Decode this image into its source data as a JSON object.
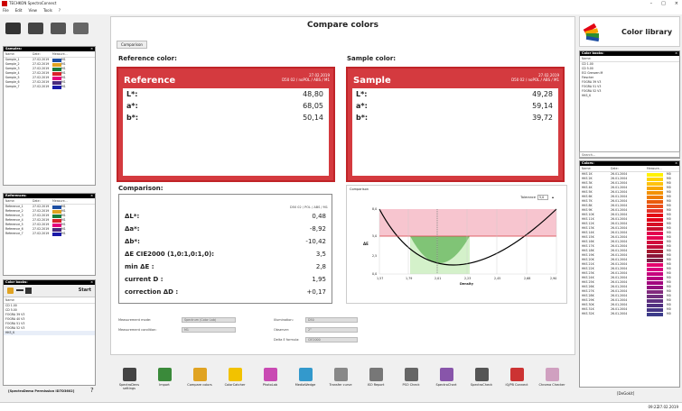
{
  "window": {
    "title": "TECHKON SpectroConnect",
    "controls": [
      "–",
      "□",
      "×"
    ]
  },
  "menu": [
    "File",
    "Edit",
    "View",
    "Tools",
    "?"
  ],
  "samples": {
    "title": "Samples:",
    "columns": [
      "Name:",
      "Date:",
      "Measure..."
    ],
    "rows": [
      {
        "name": "Sample_1",
        "date": "27.02.2019",
        "color": "#1d4fa3",
        "m": "M1"
      },
      {
        "name": "Sample_2",
        "date": "27.02.2019",
        "color": "#e0a322",
        "m": "M1"
      },
      {
        "name": "Sample_3",
        "date": "27.02.2019",
        "color": "#1b7d3b",
        "m": "M1"
      },
      {
        "name": "Sample_4",
        "date": "27.02.2019",
        "color": "#d9232a",
        "m": "M1"
      },
      {
        "name": "Sample_5",
        "date": "27.02.2019",
        "color": "#e4007c",
        "m": "M1"
      },
      {
        "name": "Sample_6",
        "date": "27.02.2019",
        "color": "#4a2b7d",
        "m": "M1"
      },
      {
        "name": "Sample_7",
        "date": "27.02.2019",
        "color": "#1a1aa8",
        "m": "M1"
      }
    ]
  },
  "references": {
    "title": "References:",
    "columns": [
      "Name:",
      "Date:",
      "Measure..."
    ],
    "rows": [
      {
        "name": "Reference_1",
        "date": "27.02.2019",
        "color": "#1d4fa3",
        "m": "M1"
      },
      {
        "name": "Reference_2",
        "date": "27.02.2019",
        "color": "#e0a322",
        "m": "M1"
      },
      {
        "name": "Reference_3",
        "date": "27.02.2019",
        "color": "#1b7d3b",
        "m": "M1"
      },
      {
        "name": "Reference_4",
        "date": "27.02.2019",
        "color": "#d9232a",
        "m": "M1"
      },
      {
        "name": "Reference_5",
        "date": "27.02.2019",
        "color": "#e4007c",
        "m": "M1"
      },
      {
        "name": "Reference_6",
        "date": "27.02.2019",
        "color": "#4a2b7d",
        "m": "M1"
      },
      {
        "name": "Reference_7",
        "date": "27.02.2019",
        "color": "#1a1aa8",
        "m": "M1"
      }
    ]
  },
  "colorbooks_left": {
    "title": "Color books:",
    "start_label": "Start",
    "column": "Name:",
    "items": [
      "CD 1.00",
      "CD 5.00",
      "FOGRA 39 V3",
      "FOGRA 40 V3",
      "FOGRA 51 V3",
      "FOGRA 52 V3",
      "HKS_K"
    ]
  },
  "license_label": "[SpectroDemo Permission ID7D3602]",
  "main": {
    "title": "Compare colors",
    "tab": "Comparison",
    "reference_heading": "Reference color:",
    "sample_heading": "Sample color:",
    "reference": {
      "name": "Reference",
      "date": "27.02.2019",
      "cond": "D50 02 / noPOL / ABS / M1",
      "L": "48,80",
      "a": "68,05",
      "b": "50,14"
    },
    "sample": {
      "name": "Sample",
      "date": "27.02.2019",
      "cond": "D50 02 / noPOL / ABS / M1",
      "L": "49,28",
      "a": "59,14",
      "b": "39,72"
    },
    "labels": {
      "L": "L*:",
      "a": "a*:",
      "b": "b*:"
    },
    "comparison_heading": "Comparison:",
    "comparison_cond": "D50 02 / POL / ABS / M1",
    "comparison_rows": [
      {
        "k": "ΔL*:",
        "v": "0,48"
      },
      {
        "k": "Δa*:",
        "v": "-8,92"
      },
      {
        "k": "Δb*:",
        "v": "-10,42"
      },
      {
        "k": "ΔE CIE2000 (1,0:1,0:1,0):",
        "v": "3,5"
      },
      {
        "k": "min ΔE :",
        "v": "2,8"
      },
      {
        "k": "current D :",
        "v": "1,95"
      },
      {
        "k": "correction ΔD :",
        "v": "+0,17"
      }
    ],
    "graph": {
      "label": "Comparison",
      "tolerance_label": "Tolerance",
      "tolerance_value": "5,0",
      "ylabel": "ΔE",
      "xlabel": "Density",
      "yticks": [
        "8,0",
        "5,0",
        "2,5",
        "0,0"
      ],
      "xticks": [
        "1,57",
        "1,79",
        "2,01",
        "2,23",
        "2,45",
        "2,68",
        "2,90"
      ]
    },
    "settings": {
      "mode_label": "Measurement mode:",
      "mode_value": "Spectrum (Color Lab)",
      "cond_label": "Measurement condition:",
      "cond_value": "M1",
      "illum_label": "Illumination:",
      "illum_value": "D50",
      "observer_label": "Observer:",
      "observer_value": "2°",
      "formula_label": "Delta E formula:",
      "formula_value": "CIE2000"
    }
  },
  "tools": [
    {
      "label": "SpectroDens settings",
      "color": "#444"
    },
    {
      "label": "Import",
      "color": "#3a8a3a"
    },
    {
      "label": "Compare colors",
      "color": "#e0a322"
    },
    {
      "label": "ColorCatcher",
      "color": "#f2c200"
    },
    {
      "label": "PhotoLab",
      "color": "#c94ab3"
    },
    {
      "label": "MediaWedge",
      "color": "#3399cc"
    },
    {
      "label": "Transfer curve",
      "color": "#888"
    },
    {
      "label": "ISO Report",
      "color": "#777"
    },
    {
      "label": "PSO Check",
      "color": "#666"
    },
    {
      "label": "SpectroChart",
      "color": "#8855aa"
    },
    {
      "label": "SpectroCheck",
      "color": "#555"
    },
    {
      "label": "iQ/PB Connect",
      "color": "#cc3333"
    },
    {
      "label": "Chroma Checker",
      "color": "#d0a0c0"
    }
  ],
  "right": {
    "library_title": "Color library",
    "colorbooks_title": "Color books:",
    "colorbooks_column": "Name:",
    "colorbooks_items": [
      "CD 1.00",
      "CD 5.00",
      "ECI Grenzen M",
      "Fiescher",
      "FOGRA 39 V3",
      "FOGRA 51 V3",
      "FOGRA 52 V3",
      "HKS_K"
    ],
    "search_placeholder": "Search...",
    "colors_title": "Colors:",
    "colors_columns": [
      "Name:",
      "Date:",
      "Measure..."
    ],
    "colors_rows": [
      {
        "n": "HKS 1K",
        "d": "26.01.2004",
        "c": "#fff200",
        "m": "M0"
      },
      {
        "n": "HKS 2K",
        "d": "26.01.2004",
        "c": "#ffd400",
        "m": "M0"
      },
      {
        "n": "HKS 3K",
        "d": "26.01.2004",
        "c": "#ffc20e",
        "m": "M0"
      },
      {
        "n": "HKS 4K",
        "d": "26.01.2004",
        "c": "#f7a600",
        "m": "M0"
      },
      {
        "n": "HKS 5K",
        "d": "26.01.2004",
        "c": "#f39200",
        "m": "M0"
      },
      {
        "n": "HKS 6K",
        "d": "26.01.2004",
        "c": "#ef7d00",
        "m": "M0"
      },
      {
        "n": "HKS 7K",
        "d": "26.01.2004",
        "c": "#ea5b0c",
        "m": "M0"
      },
      {
        "n": "HKS 8K",
        "d": "26.01.2004",
        "c": "#e94e1b",
        "m": "M0"
      },
      {
        "n": "HKS 9K",
        "d": "26.01.2004",
        "c": "#e6352b",
        "m": "M0"
      },
      {
        "n": "HKS 10K",
        "d": "26.01.2004",
        "c": "#e30613",
        "m": "M0"
      },
      {
        "n": "HKS 11K",
        "d": "26.01.2004",
        "c": "#e2001a",
        "m": "M0"
      },
      {
        "n": "HKS 12K",
        "d": "26.01.2004",
        "c": "#d60f24",
        "m": "M0"
      },
      {
        "n": "HKS 13K",
        "d": "26.01.2004",
        "c": "#c8102e",
        "m": "M0"
      },
      {
        "n": "HKS 14K",
        "d": "26.01.2004",
        "c": "#e3004f",
        "m": "M0"
      },
      {
        "n": "HKS 15K",
        "d": "26.01.2004",
        "c": "#e40050",
        "m": "M0"
      },
      {
        "n": "HKS 16K",
        "d": "26.01.2004",
        "c": "#d20a3c",
        "m": "M0"
      },
      {
        "n": "HKS 17K",
        "d": "26.01.2004",
        "c": "#c00d3a",
        "m": "M0"
      },
      {
        "n": "HKS 18K",
        "d": "26.01.2004",
        "c": "#a6192e",
        "m": "M0"
      },
      {
        "n": "HKS 19K",
        "d": "26.01.2004",
        "c": "#8a1538",
        "m": "M0"
      },
      {
        "n": "HKS 20K",
        "d": "26.01.2004",
        "c": "#7d2248",
        "m": "M0"
      },
      {
        "n": "HKS 21K",
        "d": "26.01.2004",
        "c": "#e5006d",
        "m": "M0"
      },
      {
        "n": "HKS 22K",
        "d": "26.01.2004",
        "c": "#d9007e",
        "m": "M0"
      },
      {
        "n": "HKS 23K",
        "d": "26.01.2004",
        "c": "#c6007e",
        "m": "M0"
      },
      {
        "n": "HKS 24K",
        "d": "26.01.2004",
        "c": "#b5007e",
        "m": "M0"
      },
      {
        "n": "HKS 25K",
        "d": "26.01.2004",
        "c": "#a3007e",
        "m": "M0"
      },
      {
        "n": "HKS 26K",
        "d": "26.01.2004",
        "c": "#93107e",
        "m": "M0"
      },
      {
        "n": "HKS 27K",
        "d": "26.01.2004",
        "c": "#822a7e",
        "m": "M0"
      },
      {
        "n": "HKS 28K",
        "d": "26.01.2004",
        "c": "#70307e",
        "m": "M0"
      },
      {
        "n": "HKS 29K",
        "d": "26.01.2004",
        "c": "#5f3080",
        "m": "M0"
      },
      {
        "n": "HKS 30K",
        "d": "26.01.2004",
        "c": "#503080",
        "m": "M0"
      },
      {
        "n": "HKS 31K",
        "d": "26.01.2004",
        "c": "#463585",
        "m": "M0"
      },
      {
        "n": "HKS 32K",
        "d": "26.01.2004",
        "c": "#3c3c8a",
        "m": "M0"
      }
    ],
    "user_label": "[DeGokit]"
  },
  "status": {
    "time": "09:22",
    "date": "27.02.2019"
  }
}
